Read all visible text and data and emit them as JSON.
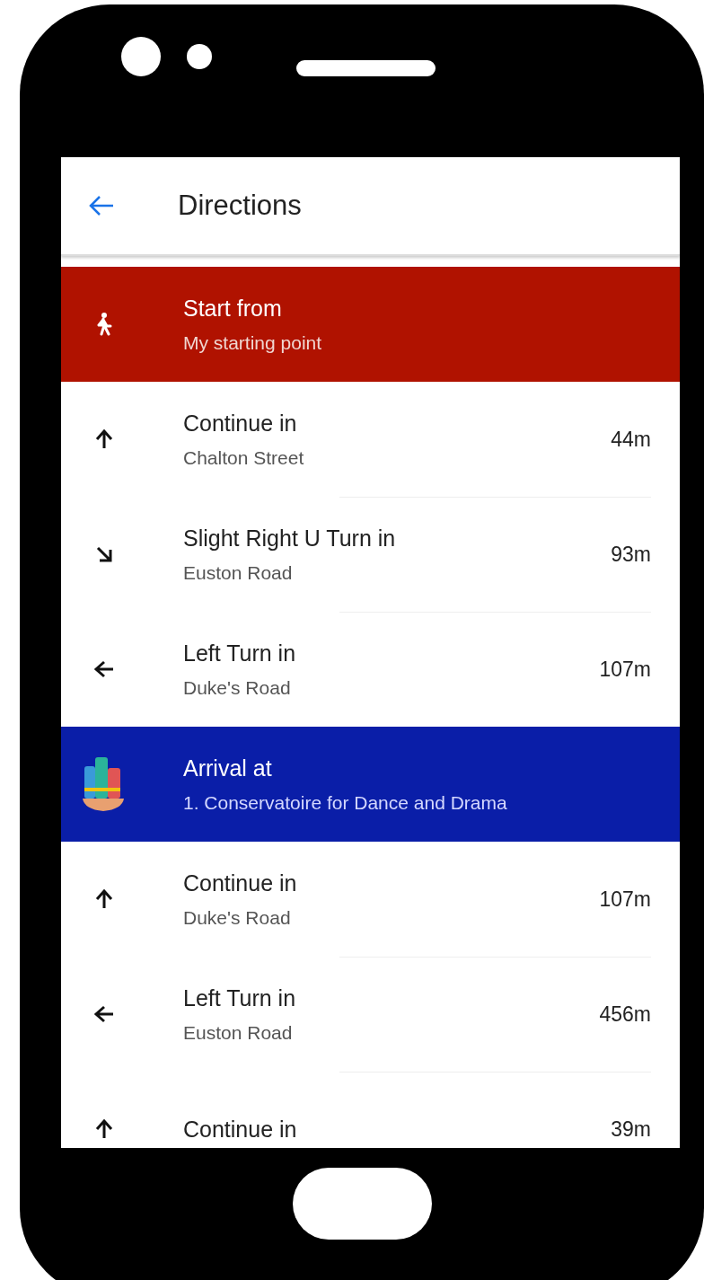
{
  "header": {
    "title": "Directions"
  },
  "steps": [
    {
      "kind": "start",
      "title": "Start from",
      "subtitle": "My starting point"
    },
    {
      "kind": "straight",
      "title": "Continue in",
      "subtitle": "Chalton Street",
      "distance": "44m"
    },
    {
      "kind": "slight-right",
      "title": "Slight Right U Turn in",
      "subtitle": "Euston Road",
      "distance": "93m"
    },
    {
      "kind": "left",
      "title": "Left Turn in",
      "subtitle": "Duke's Road",
      "distance": "107m"
    },
    {
      "kind": "arrival",
      "title": "Arrival at",
      "subtitle": "1. Conservatoire for Dance and Drama"
    },
    {
      "kind": "straight",
      "title": "Continue in",
      "subtitle": "Duke's Road",
      "distance": "107m"
    },
    {
      "kind": "left",
      "title": "Left Turn in",
      "subtitle": "Euston Road",
      "distance": "456m"
    },
    {
      "kind": "straight",
      "title": "Continue in",
      "distance": "39m"
    }
  ]
}
